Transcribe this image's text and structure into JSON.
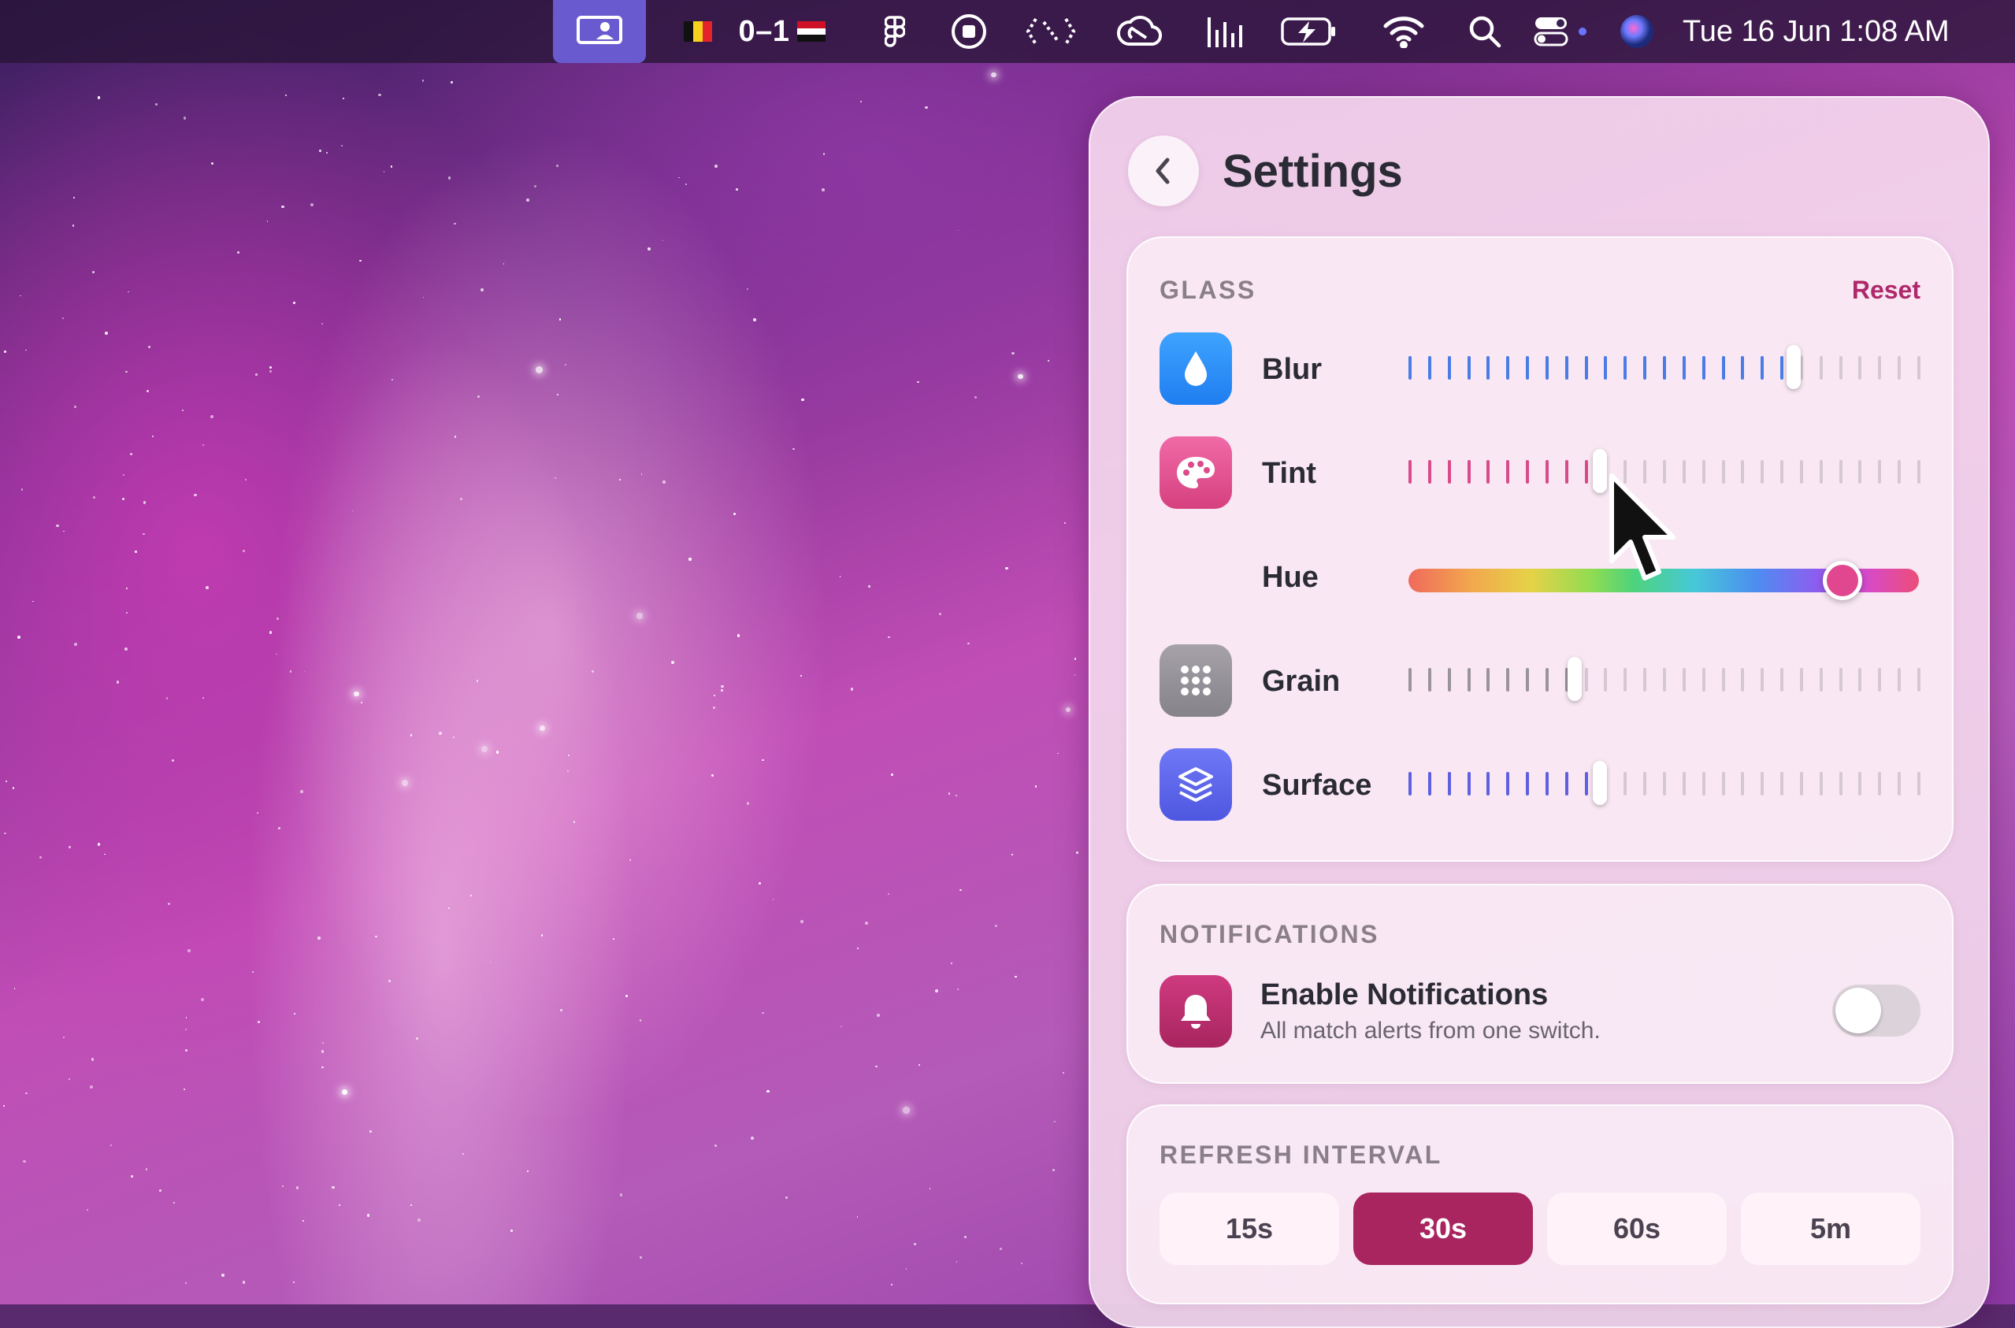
{
  "menubar": {
    "score": "0–1",
    "clock": "Tue 16 Jun  1:08 AM",
    "icons": [
      "screen-share-icon",
      "belgium-flag-icon",
      "egypt-flag-icon",
      "figma-icon",
      "record-stop-icon",
      "dotted-brackets-icon",
      "creative-cloud-icon",
      "audio-levels-icon",
      "battery-charging-icon",
      "wifi-icon",
      "search-icon",
      "control-center-icon",
      "siri-icon"
    ]
  },
  "settings": {
    "title": "Settings",
    "back_icon": "chevron-left-icon"
  },
  "glass": {
    "section_label": "GLASS",
    "reset_label": "Reset",
    "rows": [
      {
        "label": "Blur",
        "icon": "water-drop-icon",
        "icon_color": "#2f8cf5",
        "tick_color": "#4a7ce6",
        "value": 0.76
      },
      {
        "label": "Tint",
        "icon": "palette-icon",
        "icon_color": "#e0478f",
        "tick_color": "#d94a8a",
        "value": 0.37
      },
      {
        "label": "Grain",
        "icon": "grid-dots-icon",
        "icon_color": "#8e8a90",
        "tick_color": "#9a9499",
        "value": 0.32
      },
      {
        "label": "Surface",
        "icon": "layers-icon",
        "icon_color": "#5a64e8",
        "tick_color": "#5f60e0",
        "value": 0.37
      }
    ],
    "hue": {
      "label": "Hue",
      "value": 0.88
    }
  },
  "notifications": {
    "section_label": "NOTIFICATIONS",
    "title": "Enable Notifications",
    "subtitle": "All match alerts from one switch.",
    "icon": "bell-icon",
    "icon_color": "#b52a6b",
    "enabled": false
  },
  "refresh": {
    "section_label": "REFRESH INTERVAL",
    "options": [
      "15s",
      "30s",
      "60s",
      "5m"
    ],
    "selected": "30s"
  }
}
